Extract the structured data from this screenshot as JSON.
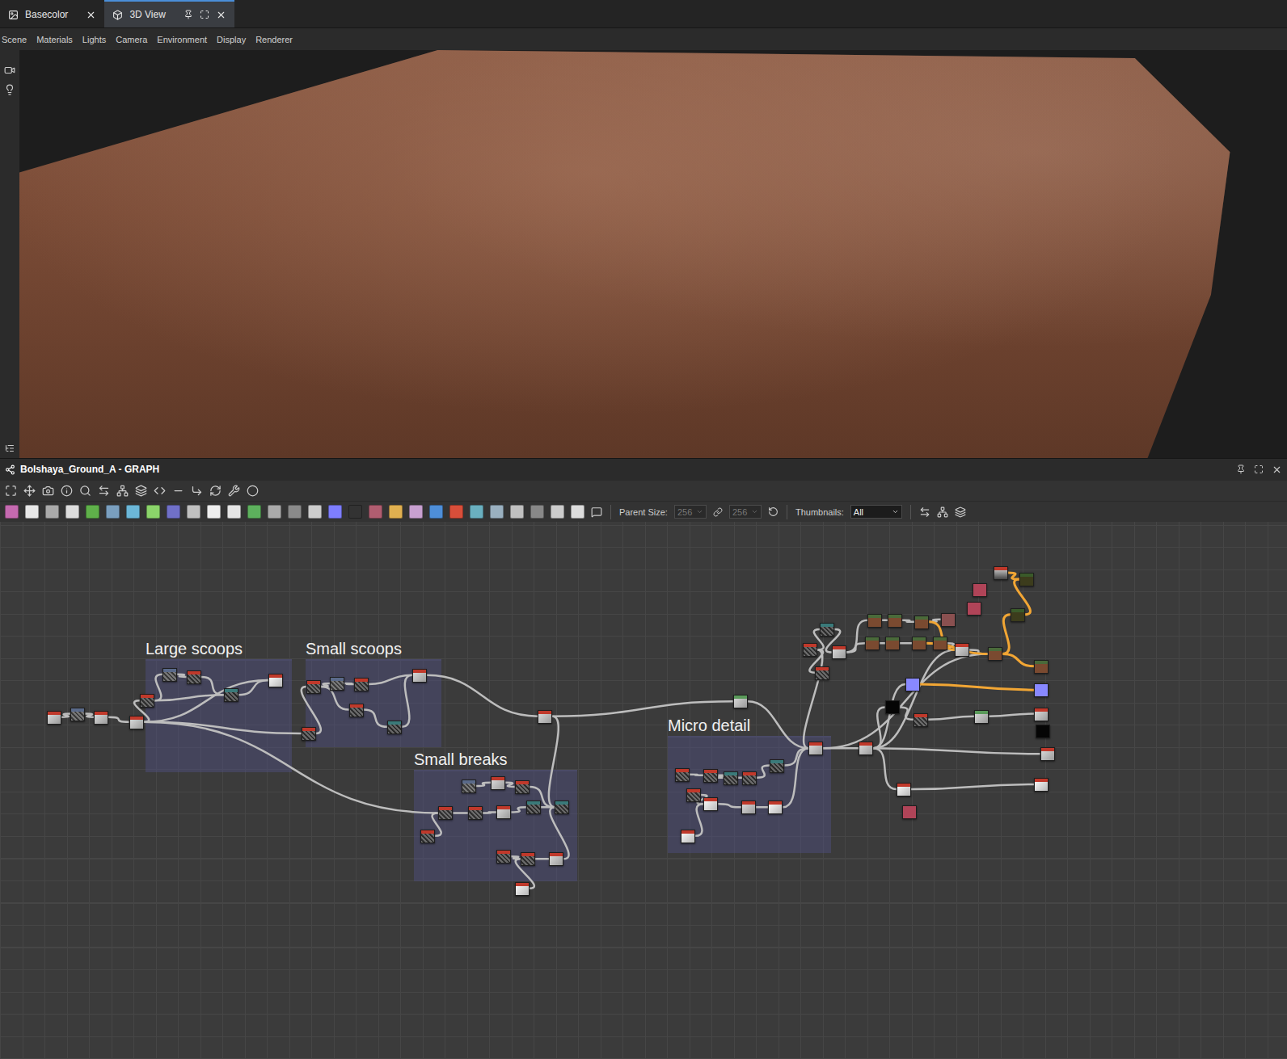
{
  "tabs": [
    {
      "label": "Basecolor",
      "selected": false
    },
    {
      "label": "3D View",
      "selected": true
    }
  ],
  "menu": [
    "Scene",
    "Materials",
    "Lights",
    "Camera",
    "Environment",
    "Display",
    "Renderer"
  ],
  "graph": {
    "title": "Bolshaya_Ground_A - GRAPH"
  },
  "toolbar": {
    "parent_size_label": "Parent Size:",
    "parent_width": "256",
    "parent_height": "256",
    "parent_size_disabled": true,
    "thumbnails_label": "Thumbnails:",
    "thumbnails_value": "All"
  },
  "frames": [
    {
      "title": "Large scoops"
    },
    {
      "title": "Small scoops"
    },
    {
      "title": "Small breaks"
    },
    {
      "title": "Micro detail"
    }
  ]
}
